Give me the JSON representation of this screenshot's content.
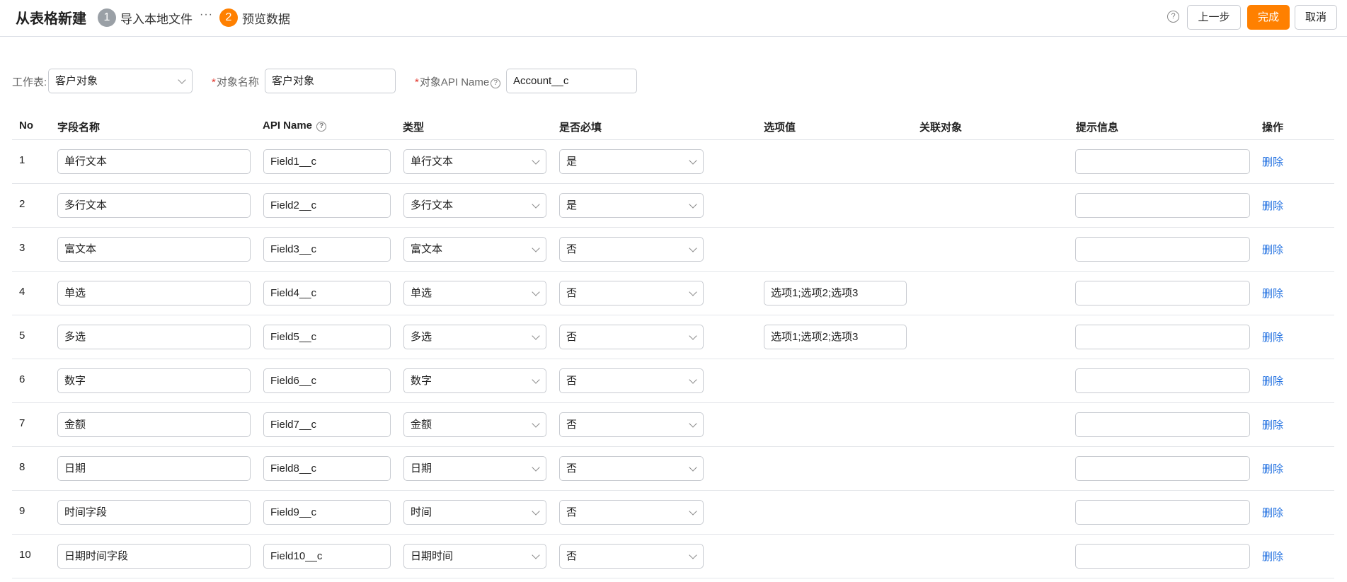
{
  "header": {
    "title": "从表格新建",
    "steps": [
      {
        "num": "1",
        "label": "导入本地文件"
      },
      {
        "num": "2",
        "label": "预览数据"
      }
    ],
    "dots": "···",
    "help_glyph": "?",
    "buttons": {
      "prev": "上一步",
      "done": "完成",
      "cancel": "取消"
    }
  },
  "form": {
    "sheet_label": "工作表:",
    "sheet_value": "客户对象",
    "object_name_label": "对象名称",
    "object_name_value": "客户对象",
    "object_api_label": "对象API Name",
    "object_api_value": "Account__c",
    "required_mark": "*"
  },
  "table": {
    "columns": {
      "no": "No",
      "field_name": "字段名称",
      "api_name": "API Name",
      "type": "类型",
      "required": "是否必填",
      "options": "选项值",
      "related": "关联对象",
      "hint": "提示信息",
      "action": "操作"
    },
    "delete_label": "删除",
    "rows": [
      {
        "no": "1",
        "field_name": "单行文本",
        "api_name": "Field1__c",
        "type": "单行文本",
        "required": "是",
        "options": null,
        "hint": ""
      },
      {
        "no": "2",
        "field_name": "多行文本",
        "api_name": "Field2__c",
        "type": "多行文本",
        "required": "是",
        "options": null,
        "hint": ""
      },
      {
        "no": "3",
        "field_name": "富文本",
        "api_name": "Field3__c",
        "type": "富文本",
        "required": "否",
        "options": null,
        "hint": ""
      },
      {
        "no": "4",
        "field_name": "单选",
        "api_name": "Field4__c",
        "type": "单选",
        "required": "否",
        "options": "选项1;选项2;选项3",
        "hint": ""
      },
      {
        "no": "5",
        "field_name": "多选",
        "api_name": "Field5__c",
        "type": "多选",
        "required": "否",
        "options": "选项1;选项2;选项3",
        "hint": ""
      },
      {
        "no": "6",
        "field_name": "数字",
        "api_name": "Field6__c",
        "type": "数字",
        "required": "否",
        "options": null,
        "hint": ""
      },
      {
        "no": "7",
        "field_name": "金额",
        "api_name": "Field7__c",
        "type": "金额",
        "required": "否",
        "options": null,
        "hint": ""
      },
      {
        "no": "8",
        "field_name": "日期",
        "api_name": "Field8__c",
        "type": "日期",
        "required": "否",
        "options": null,
        "hint": ""
      },
      {
        "no": "9",
        "field_name": "时间字段",
        "api_name": "Field9__c",
        "type": "时间",
        "required": "否",
        "options": null,
        "hint": ""
      },
      {
        "no": "10",
        "field_name": "日期时间字段",
        "api_name": "Field10__c",
        "type": "日期时间",
        "required": "否",
        "options": null,
        "hint": ""
      }
    ]
  }
}
